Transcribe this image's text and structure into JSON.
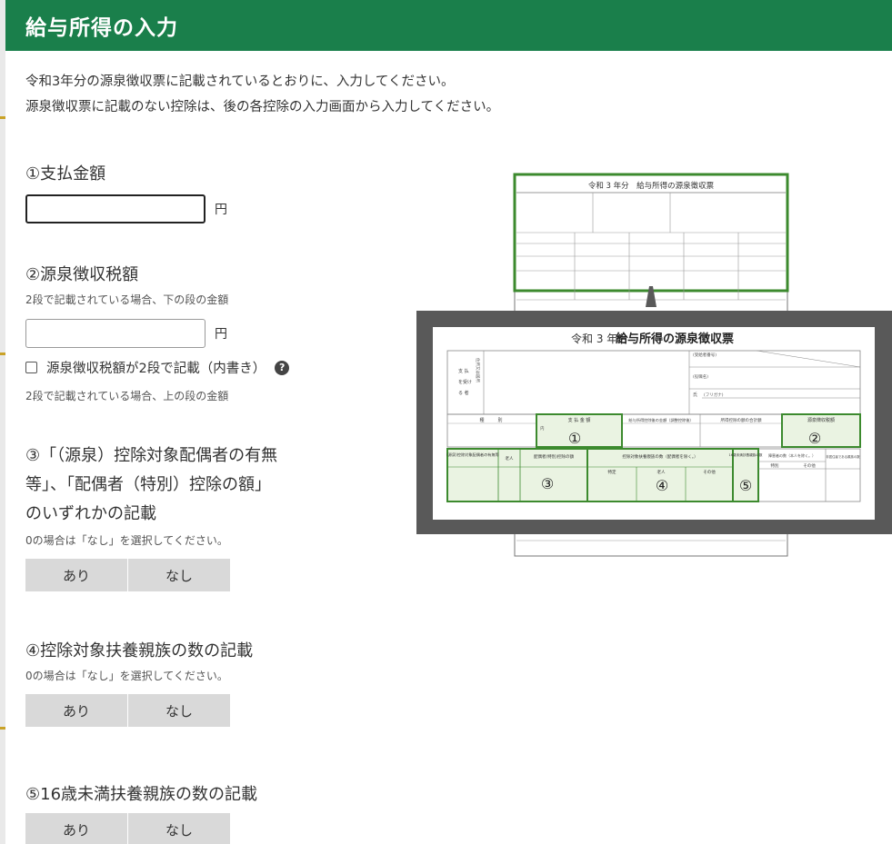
{
  "modal": {
    "title": "給与所得の入力"
  },
  "intro": {
    "line1": "令和3年分の源泉徴収票に記載されているとおりに、入力してください。",
    "line2": "源泉徴収票に記載のない控除は、後の各控除の入力画面から入力してください。"
  },
  "q1": {
    "title": "①支払金額",
    "value": "",
    "unit": "円"
  },
  "q2": {
    "title": "②源泉徴収税額",
    "note_top": "2段で記載されている場合、下の段の金額",
    "value": "",
    "unit": "円",
    "checkbox_label": "源泉徴収税額が2段で記載（内書き）",
    "help": "?",
    "note_bottom": "2段で記載されている場合、上の段の金額"
  },
  "q3": {
    "title_line1": "③「（源泉）控除対象配偶者の有無",
    "title_line2": "等」、「配偶者（特別）控除の額」",
    "title_line3": "のいずれかの記載",
    "note": "0の場合は「なし」を選択してください。",
    "yes": "あり",
    "no": "なし"
  },
  "q4": {
    "title": "④控除対象扶養親族の数の記載",
    "note": "0の場合は「なし」を選択してください。",
    "yes": "あり",
    "no": "なし"
  },
  "q5": {
    "title": "⑤16歳未満扶養親族の数の記載",
    "yes": "あり",
    "no": "なし"
  },
  "figure": {
    "small_header": "令和 3 年分　給与所得の源泉徴収票",
    "era": "令和 3 年分",
    "form_title": "給与所得の源泉徴収票",
    "side_label": [
      "支 払",
      "を受け",
      "る 者"
    ],
    "address_label": "住所又は居所",
    "id_label": "(受給者番号)",
    "role_label": "(役職名)",
    "name_label": "氏",
    "kana_label": "(フリガナ)",
    "col_type": "種　　　別",
    "col_pay": "支 払 金 額",
    "col_after": "給与所得控除後の金額（調整控除後）",
    "col_total": "所得控除の額の合計額",
    "col_tax": "源泉徴収税額",
    "col_spouse": "(源泉)控除対象配偶者の有無等",
    "col_spouse_old": "老人",
    "col_spouse_amt": "配偶者(特別)控除の額",
    "col_dependents": "控除対象扶養親族の数（配偶者を除く。）",
    "col_dep_specific": "特定",
    "col_dep_old": "老人",
    "col_dep_other": "その他",
    "col_under16": "16歳未満扶養親族の数",
    "col_disabled": "障害者の数（本人を除く。）",
    "col_disabled_special": "特別",
    "col_disabled_other": "その他",
    "col_nonresident": "非居住者である親族の数",
    "unit_sen": "千",
    "unit_en": "円",
    "unit_nin": "人",
    "unit_uchi": "内",
    "marker_1": "①",
    "marker_2": "②",
    "marker_3": "③",
    "marker_4": "④",
    "marker_5": "⑤",
    "colors": {
      "green": "#3c8a2e",
      "highlight": "#eaf3e2",
      "frame": "#595959"
    }
  }
}
